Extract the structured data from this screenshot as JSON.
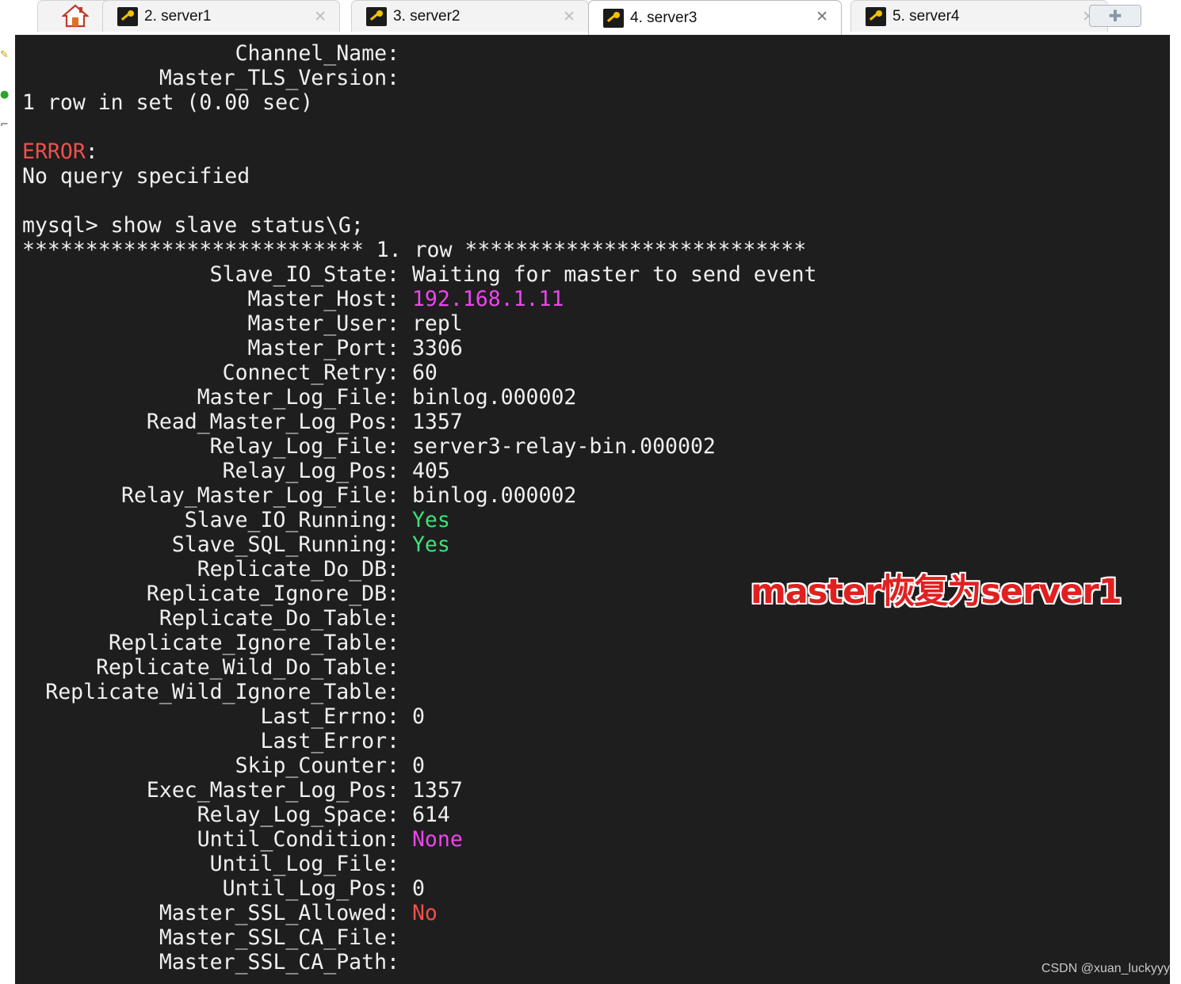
{
  "tabs": [
    {
      "label": "2. server1",
      "icon": "key-icon",
      "active": false
    },
    {
      "label": "3. server2",
      "icon": "key-icon",
      "active": false
    },
    {
      "label": "4. server3",
      "icon": "key-icon",
      "active": true
    },
    {
      "label": "5. server4",
      "icon": "key-icon",
      "active": false
    }
  ],
  "colors": {
    "terminal_bg": "#1e1e1e",
    "text": "#f0f0f0",
    "error": "#f0504a",
    "ok": "#3ee07c",
    "highlight": "#ee44ee",
    "annotation": "#e02020"
  },
  "terminal": {
    "pre": {
      "channel_name": "Channel_Name:",
      "tls_version": "Master_TLS_Version:",
      "row_in_set": "1 row in set (0.00 sec)",
      "error_word": "ERROR",
      "error_colon": ":",
      "no_query": "No query specified",
      "prompt": "mysql> show slave status\\G;",
      "row_header": "*************************** 1. row ***************************"
    },
    "fields": [
      {
        "key": "Slave_IO_State:",
        "value": "Waiting for master to send event",
        "color": ""
      },
      {
        "key": "Master_Host:",
        "value": "192.168.1.11",
        "color": "magenta"
      },
      {
        "key": "Master_User:",
        "value": "repl",
        "color": ""
      },
      {
        "key": "Master_Port:",
        "value": "3306",
        "color": ""
      },
      {
        "key": "Connect_Retry:",
        "value": "60",
        "color": ""
      },
      {
        "key": "Master_Log_File:",
        "value": "binlog.000002",
        "color": ""
      },
      {
        "key": "Read_Master_Log_Pos:",
        "value": "1357",
        "color": ""
      },
      {
        "key": "Relay_Log_File:",
        "value": "server3-relay-bin.000002",
        "color": ""
      },
      {
        "key": "Relay_Log_Pos:",
        "value": "405",
        "color": ""
      },
      {
        "key": "Relay_Master_Log_File:",
        "value": "binlog.000002",
        "color": ""
      },
      {
        "key": "Slave_IO_Running:",
        "value": "Yes",
        "color": "green"
      },
      {
        "key": "Slave_SQL_Running:",
        "value": "Yes",
        "color": "green"
      },
      {
        "key": "Replicate_Do_DB:",
        "value": "",
        "color": ""
      },
      {
        "key": "Replicate_Ignore_DB:",
        "value": "",
        "color": ""
      },
      {
        "key": "Replicate_Do_Table:",
        "value": "",
        "color": ""
      },
      {
        "key": "Replicate_Ignore_Table:",
        "value": "",
        "color": ""
      },
      {
        "key": "Replicate_Wild_Do_Table:",
        "value": "",
        "color": ""
      },
      {
        "key": "Replicate_Wild_Ignore_Table:",
        "value": "",
        "color": ""
      },
      {
        "key": "Last_Errno:",
        "value": "0",
        "color": ""
      },
      {
        "key": "Last_Error:",
        "value": "",
        "color": ""
      },
      {
        "key": "Skip_Counter:",
        "value": "0",
        "color": ""
      },
      {
        "key": "Exec_Master_Log_Pos:",
        "value": "1357",
        "color": ""
      },
      {
        "key": "Relay_Log_Space:",
        "value": "614",
        "color": ""
      },
      {
        "key": "Until_Condition:",
        "value": "None",
        "color": "magenta"
      },
      {
        "key": "Until_Log_File:",
        "value": "",
        "color": ""
      },
      {
        "key": "Until_Log_Pos:",
        "value": "0",
        "color": ""
      },
      {
        "key": "Master_SSL_Allowed:",
        "value": "No",
        "color": "red"
      },
      {
        "key": "Master_SSL_CA_File:",
        "value": "",
        "color": ""
      },
      {
        "key": "Master_SSL_CA_Path:",
        "value": "",
        "color": ""
      }
    ]
  },
  "annotation": "master恢复为server1",
  "watermark": "CSDN @xuan_luckyyy"
}
